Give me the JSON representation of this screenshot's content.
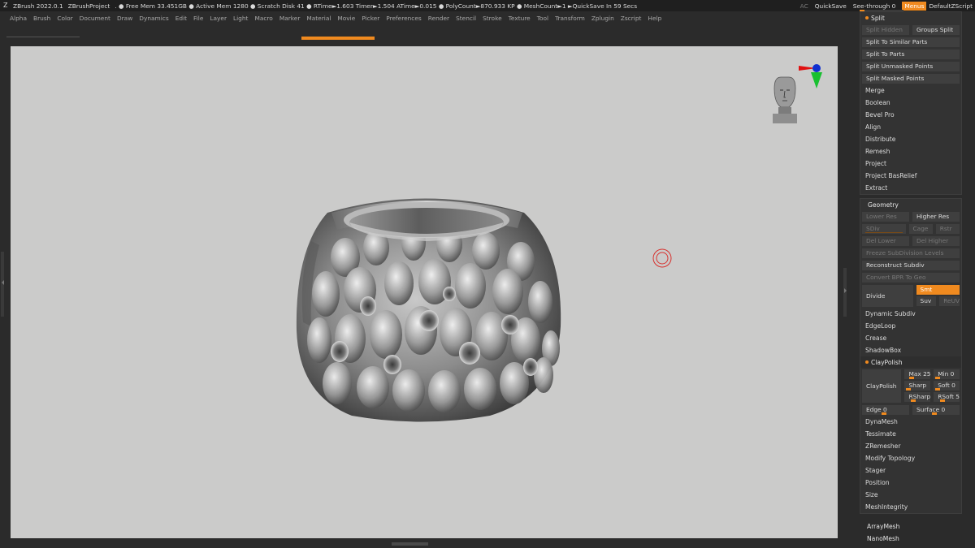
{
  "titlebar": {
    "app": "ZBrush 2022.0.1",
    "project": "ZBrushProject",
    "stats": ". ● Free Mem 33.451GB ● Active Mem 1280 ● Scratch Disk 41 ● RTime►1.603 Timer►1.504 ATime►0.015 ● PolyCount►870.933 KP ● MeshCount►1 ►QuickSave In 59 Secs",
    "ac": "AC",
    "quicksave": "QuickSave",
    "seethrough": "See-through  0",
    "menus": "Menus",
    "script": "DefaultZScript",
    "accent": "#f08a1f"
  },
  "menubar": [
    "Alpha",
    "Brush",
    "Color",
    "Document",
    "Draw",
    "Dynamics",
    "Edit",
    "File",
    "Layer",
    "Light",
    "Macro",
    "Marker",
    "Material",
    "Movie",
    "Picker",
    "Preferences",
    "Render",
    "Stencil",
    "Stroke",
    "Texture",
    "Tool",
    "Transform",
    "Zplugin",
    "Zscript",
    "Help"
  ],
  "split": {
    "title": "Split",
    "split_hidden": "Split Hidden",
    "groups_split": "Groups Split",
    "to_similar": "Split To Similar Parts",
    "to_parts": "Split To Parts",
    "unmasked": "Split Unmasked Points",
    "masked": "Split Masked Points",
    "items": [
      "Merge",
      "Boolean",
      "Bevel Pro",
      "Align",
      "Distribute",
      "Remesh",
      "Project",
      "Project BasRelief",
      "Extract"
    ]
  },
  "geometry": {
    "title": "Geometry",
    "lower_res": "Lower Res",
    "higher_res": "Higher Res",
    "sdiv": "SDiv",
    "cage": "Cage",
    "rstr": "Rstr",
    "del_lower": "Del Lower",
    "del_higher": "Del Higher",
    "freeze": "Freeze SubDivision Levels",
    "reconstruct": "Reconstruct Subdiv",
    "convert": "Convert BPR To Geo",
    "divide": "Divide",
    "smt": "Smt",
    "suv": "Suv",
    "reuv": "ReUV",
    "items_a": [
      "Dynamic Subdiv",
      "EdgeLoop",
      "Crease",
      "ShadowBox"
    ],
    "claypolish_header": "ClayPolish",
    "claypolish_btn": "ClayPolish",
    "max": "Max 25",
    "min": "Min 0",
    "sharp": "Sharp",
    "soft": "Soft 0",
    "rsharp": "RSharp",
    "rsoft": "RSoft 5",
    "edge": "Edge 0",
    "surface": "Surface 0",
    "items_b": [
      "DynaMesh",
      "Tessimate",
      "ZRemesher",
      "Modify Topology",
      "Stager",
      "Position",
      "Size",
      "MeshIntegrity"
    ]
  },
  "extras": [
    "ArrayMesh",
    "NanoMesh"
  ]
}
